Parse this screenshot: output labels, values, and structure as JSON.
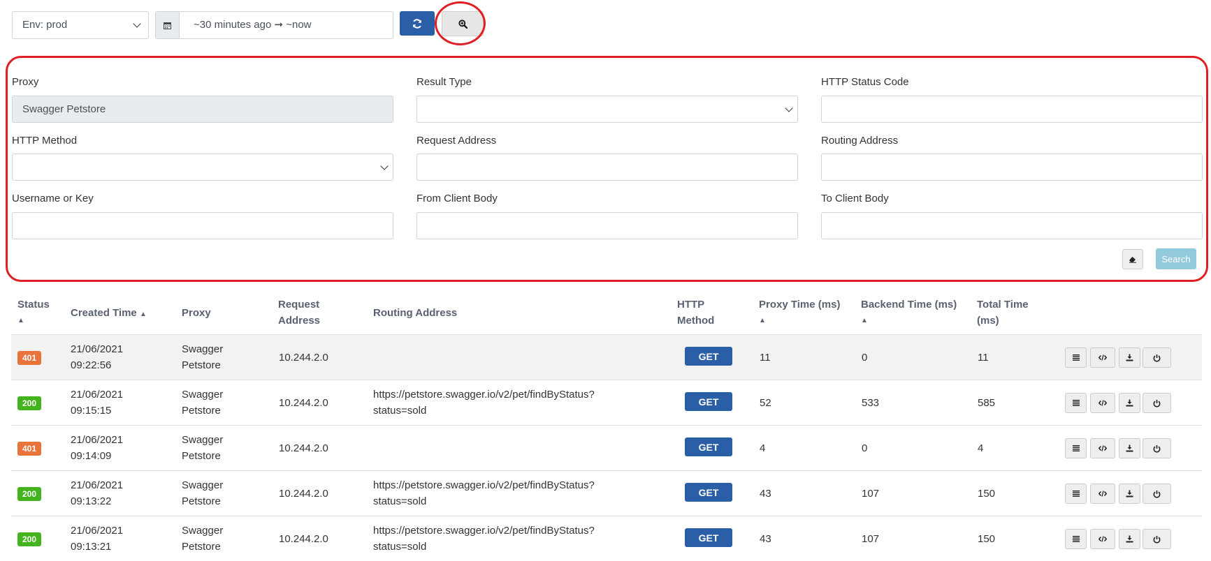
{
  "toolbar": {
    "env_value": "Env: prod",
    "date_range": "~30 minutes ago ➞ ~now",
    "icons": {
      "calendar": "calendar-icon",
      "refresh": "refresh-icon",
      "zoom": "zoom-in-icon"
    }
  },
  "filters": {
    "proxy_label": "Proxy",
    "proxy_value": "Swagger Petstore",
    "result_type_label": "Result Type",
    "http_status_label": "HTTP Status Code",
    "http_method_label": "HTTP Method",
    "request_address_label": "Request Address",
    "routing_address_label": "Routing Address",
    "username_label": "Username or Key",
    "from_client_label": "From Client Body",
    "to_client_label": "To Client Body",
    "search_label": "Search"
  },
  "table": {
    "headers": {
      "status": "Status",
      "created_time": "Created Time",
      "proxy": "Proxy",
      "request_address_1": "Request",
      "request_address_2": "Address",
      "routing_address": "Routing Address",
      "http_method_1": "HTTP",
      "http_method_2": "Method",
      "proxy_time": "Proxy Time (ms)",
      "backend_time": "Backend Time (ms)",
      "total_time_1": "Total Time",
      "total_time_2": "(ms)"
    },
    "rows": [
      {
        "status": "401",
        "status_color": "#e8743b",
        "date": "21/06/2021",
        "time": "09:22:56",
        "proxy_1": "Swagger",
        "proxy_2": "Petstore",
        "request": "10.244.2.0",
        "routing_1": "",
        "routing_2": "",
        "method": "GET",
        "proxy_time": "11",
        "backend_time": "0",
        "total_time": "11"
      },
      {
        "status": "200",
        "status_color": "#43b31e",
        "date": "21/06/2021",
        "time": "09:15:15",
        "proxy_1": "Swagger",
        "proxy_2": "Petstore",
        "request": "10.244.2.0",
        "routing_1": "https://petstore.swagger.io/v2/pet/findByStatus?",
        "routing_2": "status=sold",
        "method": "GET",
        "proxy_time": "52",
        "backend_time": "533",
        "total_time": "585"
      },
      {
        "status": "401",
        "status_color": "#e8743b",
        "date": "21/06/2021",
        "time": "09:14:09",
        "proxy_1": "Swagger",
        "proxy_2": "Petstore",
        "request": "10.244.2.0",
        "routing_1": "",
        "routing_2": "",
        "method": "GET",
        "proxy_time": "4",
        "backend_time": "0",
        "total_time": "4"
      },
      {
        "status": "200",
        "status_color": "#43b31e",
        "date": "21/06/2021",
        "time": "09:13:22",
        "proxy_1": "Swagger",
        "proxy_2": "Petstore",
        "request": "10.244.2.0",
        "routing_1": "https://petstore.swagger.io/v2/pet/findByStatus?",
        "routing_2": "status=sold",
        "method": "GET",
        "proxy_time": "43",
        "backend_time": "107",
        "total_time": "150"
      },
      {
        "status": "200",
        "status_color": "#43b31e",
        "date": "21/06/2021",
        "time": "09:13:21",
        "proxy_1": "Swagger",
        "proxy_2": "Petstore",
        "request": "10.244.2.0",
        "routing_1": "https://petstore.swagger.io/v2/pet/findByStatus?",
        "routing_2": "status=sold",
        "method": "GET",
        "proxy_time": "43",
        "backend_time": "107",
        "total_time": "150"
      }
    ],
    "row_actions": [
      "list-icon",
      "code-icon",
      "download-icon",
      "replay-icon"
    ]
  },
  "colors": {
    "primary": "#2a5ea6",
    "highlight": "#e01e24",
    "info": "#93c9dd"
  }
}
